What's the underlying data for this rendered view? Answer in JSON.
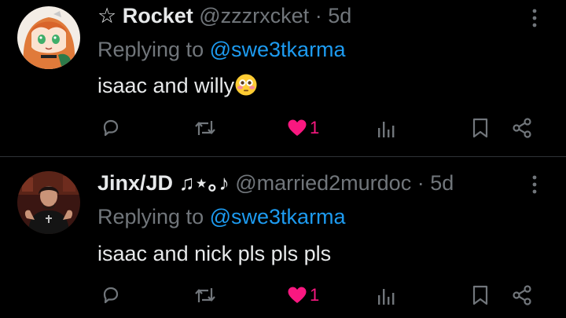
{
  "colors": {
    "background": "#000000",
    "text": "#e7e9ea",
    "secondary": "#71767b",
    "mention": "#1d9bf0",
    "like": "#f91880",
    "divider": "#2f3336"
  },
  "tweets": [
    {
      "display_name": "☆ Rocket",
      "handle": "@zzzrxcket",
      "separator": "·",
      "time": "5d",
      "replying_prefix": "Replying to",
      "replying_to": "@swe3tkarma",
      "text": "isaac and willy",
      "emoji": "flushed-face-emoji",
      "avatar": "anime-girl-avatar",
      "actions": {
        "reply_icon": "reply-icon",
        "retweet_icon": "retweet-icon",
        "like_icon": "heart-filled-icon",
        "like_count": "1",
        "views_icon": "views-icon",
        "bookmark_icon": "bookmark-icon",
        "share_icon": "share-icon"
      }
    },
    {
      "display_name": "Jinx/JD ♫⋆｡♪",
      "handle": "@married2murdoc",
      "separator": "·",
      "time": "5d",
      "replying_prefix": "Replying to",
      "replying_to": "@swe3tkarma",
      "text": "isaac and nick pls pls pls",
      "avatar": "person-photo-avatar",
      "actions": {
        "reply_icon": "reply-icon",
        "retweet_icon": "retweet-icon",
        "like_icon": "heart-filled-icon",
        "like_count": "1",
        "views_icon": "views-icon",
        "bookmark_icon": "bookmark-icon",
        "share_icon": "share-icon"
      }
    }
  ]
}
